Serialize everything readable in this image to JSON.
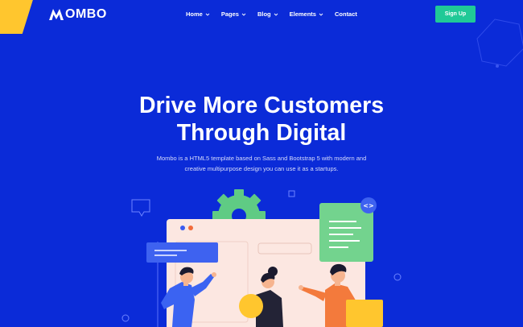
{
  "header": {
    "logo_text": "OMBO",
    "nav": [
      {
        "label": "Home",
        "has_dropdown": true
      },
      {
        "label": "Pages",
        "has_dropdown": true
      },
      {
        "label": "Blog",
        "has_dropdown": true
      },
      {
        "label": "Elements",
        "has_dropdown": true
      },
      {
        "label": "Contact",
        "has_dropdown": false
      }
    ],
    "signup_label": "Sign Up"
  },
  "hero": {
    "title_line1": "Drive More Customers",
    "title_line2": "Through Digital",
    "subtitle_line1": "Mombo is a HTML5 template based on Sass and Bootstrap 5 with modern and",
    "subtitle_line2": "creative multipurpose design you can use it as a startups."
  },
  "illustration": {
    "code_badge": "<>"
  },
  "colors": {
    "background": "#0b2bd8",
    "accent_green": "#20c997",
    "yellow": "#ffc62e",
    "window": "#fce7e1",
    "card_green": "#73d38e"
  }
}
